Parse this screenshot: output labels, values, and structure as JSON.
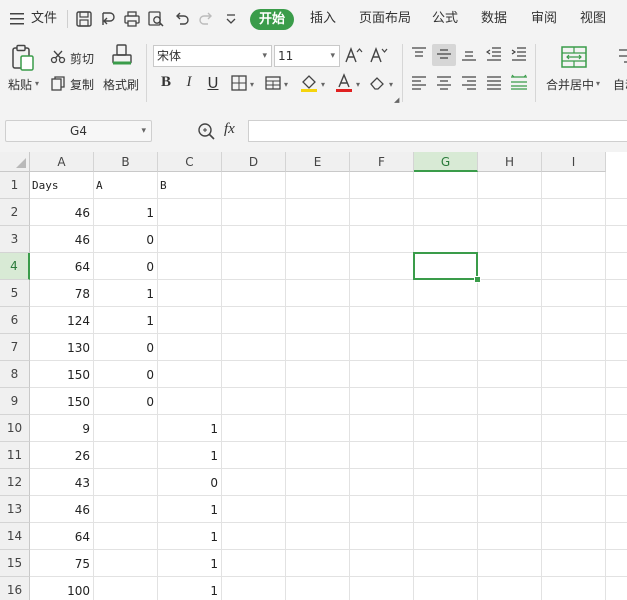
{
  "menubar": {
    "file_label": "文件",
    "tabs": [
      {
        "label": "开始"
      },
      {
        "label": "插入"
      },
      {
        "label": "页面布局"
      },
      {
        "label": "公式"
      },
      {
        "label": "数据"
      },
      {
        "label": "审阅"
      },
      {
        "label": "视图"
      }
    ]
  },
  "ribbon": {
    "paste": "粘贴",
    "cut": "剪切",
    "copy": "复制",
    "format_painter": "格式刷",
    "font_name": "宋体",
    "font_size": "11",
    "bold": "B",
    "italic": "I",
    "underline": "U",
    "merge_center": "合并居中",
    "auto_wrap": "自动"
  },
  "formula_bar": {
    "name_box": "G4",
    "fx_label": "fx",
    "formula": ""
  },
  "grid": {
    "columns": [
      "A",
      "B",
      "C",
      "D",
      "E",
      "F",
      "G",
      "H",
      "I"
    ],
    "active_column": "G",
    "rows": [
      "1",
      "2",
      "3",
      "4",
      "5",
      "6",
      "7",
      "8",
      "9",
      "10",
      "11",
      "12",
      "13",
      "14",
      "15",
      "16"
    ],
    "active_row": "4",
    "selected_cell": "G4",
    "cells": {
      "A": [
        "Days",
        "46",
        "46",
        "64",
        "78",
        "124",
        "130",
        "150",
        "150",
        "9",
        "26",
        "43",
        "46",
        "64",
        "75",
        "100"
      ],
      "B": [
        "A",
        "1",
        "0",
        "0",
        "1",
        "1",
        "0",
        "0",
        "0",
        "",
        "",
        "",
        "",
        "",
        "",
        ""
      ],
      "C": [
        "B",
        "",
        "",
        "",
        "",
        "",
        "",
        "",
        "",
        "1",
        "1",
        "0",
        "1",
        "1",
        "1",
        "1"
      ]
    }
  },
  "colors": {
    "accent": "#3a9c4a",
    "header_bg": "#f0f0f0",
    "grid_line": "#e2e2e2"
  }
}
